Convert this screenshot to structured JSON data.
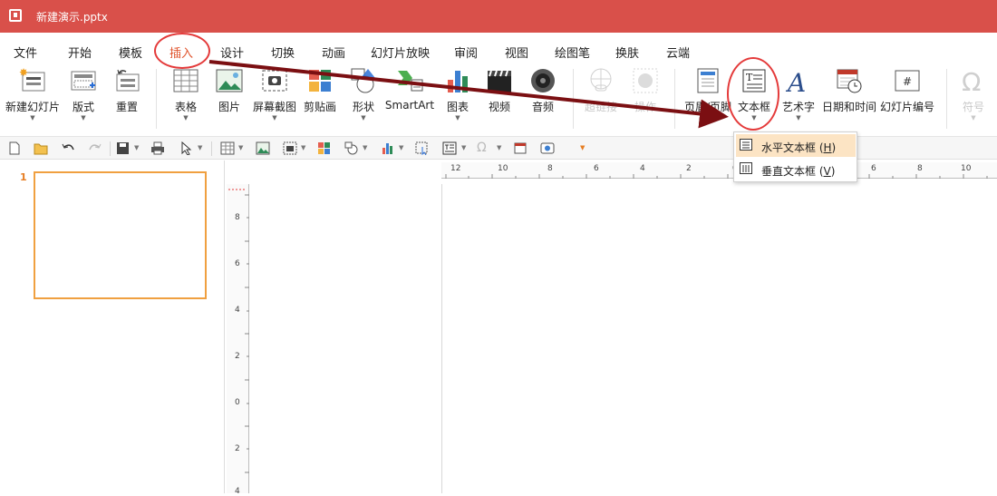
{
  "window": {
    "title": "新建演示.pptx"
  },
  "menu": [
    {
      "label": "文件"
    },
    {
      "label": "开始"
    },
    {
      "label": "模板"
    },
    {
      "label": "插入",
      "active": true
    },
    {
      "label": "设计"
    },
    {
      "label": "切换"
    },
    {
      "label": "动画"
    },
    {
      "label": "幻灯片放映"
    },
    {
      "label": "审阅"
    },
    {
      "label": "视图"
    },
    {
      "label": "绘图笔"
    },
    {
      "label": "换肤"
    },
    {
      "label": "云端"
    }
  ],
  "ribbon": {
    "new_slide": "新建幻灯片",
    "layout": "版式",
    "reset": "重置",
    "table": "表格",
    "picture": "图片",
    "screenshot": "屏幕截图",
    "clipart": "剪贴画",
    "shapes": "形状",
    "smartart": "SmartArt",
    "chart": "图表",
    "video": "视频",
    "audio": "音频",
    "hyperlink": "超链接",
    "action": "操作",
    "header_footer": "页眉/页脚",
    "textbox": "文本框",
    "wordart": "艺术字",
    "datetime": "日期和时间",
    "slide_number": "幻灯片编号",
    "symbol": "符号"
  },
  "dropdown": {
    "items": [
      {
        "label": "水平文本框",
        "key": "H"
      },
      {
        "label": "垂直文本框",
        "key": "V"
      }
    ]
  },
  "slides": {
    "current": "1"
  },
  "ruler": {
    "horizontal": [
      "12",
      "10",
      "8",
      "6",
      "4",
      "2",
      "0",
      "2",
      "4",
      "6",
      "8",
      "10"
    ],
    "vertical": [
      "8",
      "6",
      "4",
      "2",
      "0",
      "2",
      "4"
    ]
  },
  "colors": {
    "titlebar": "#d9504a",
    "accent": "#e0542d",
    "annotation": "#e43a3a",
    "arrow": "#7b0f12",
    "thumb_border": "#f0a040"
  }
}
